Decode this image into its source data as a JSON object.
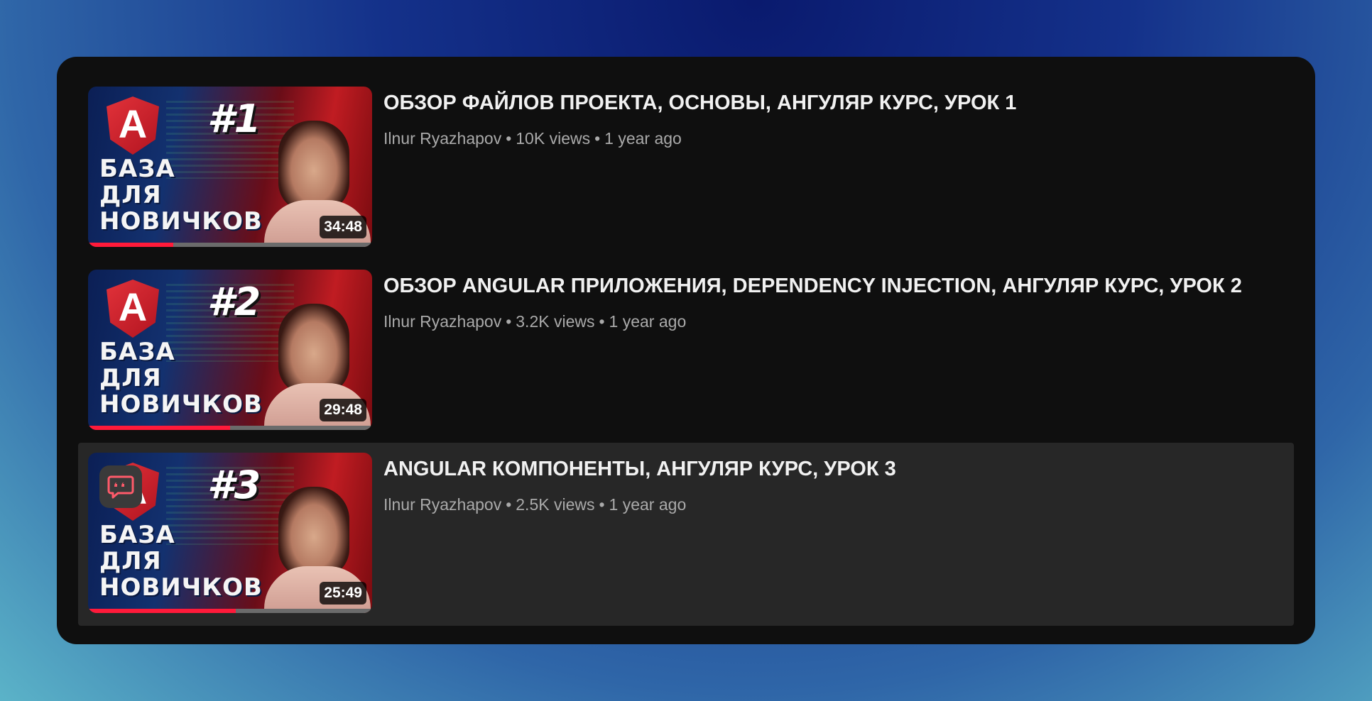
{
  "videos": [
    {
      "title": "ОБЗОР ФАЙЛОВ ПРОЕКТА, ОСНОВЫ, АНГУЛЯР КУРС, УРОК 1",
      "channel": "Ilnur Ryazhapov",
      "views": "10K views",
      "age": "1 year ago",
      "duration": "34:48",
      "watched_fraction": 0.3,
      "thumb_number": "#1",
      "thumb_caption": [
        "БАЗА",
        "ДЛЯ",
        "НОВИЧКОВ"
      ],
      "thumb_logo": "A",
      "hovered": false
    },
    {
      "title": "ОБЗОР ANGULAR ПРИЛОЖЕНИЯ, DEPENDENCY INJECTION, АНГУЛЯР КУРС, УРОК 2",
      "channel": "Ilnur Ryazhapov",
      "views": "3.2K views",
      "age": "1 year ago",
      "duration": "29:48",
      "watched_fraction": 0.5,
      "thumb_number": "#2",
      "thumb_caption": [
        "БАЗА",
        "ДЛЯ",
        "НОВИЧКОВ"
      ],
      "thumb_logo": "A",
      "hovered": false
    },
    {
      "title": "ANGULAR КОМПОНЕНТЫ, АНГУЛЯР КУРС, УРОК 3",
      "channel": "Ilnur Ryazhapov",
      "views": "2.5K views",
      "age": "1 year ago",
      "duration": "25:49",
      "watched_fraction": 0.52,
      "thumb_number": "#3",
      "thumb_caption": [
        "БАЗА",
        "ДЛЯ",
        "НОВИЧКОВ"
      ],
      "thumb_logo": "A",
      "hovered": true
    }
  ],
  "separator": "•",
  "icons": {
    "overlay": "quote-bubble-icon"
  },
  "colors": {
    "progress": "#ff1a3a",
    "hover_bg": "#272727",
    "card_bg": "#0f0f0f",
    "quote_icon": "#ff5a6a"
  }
}
